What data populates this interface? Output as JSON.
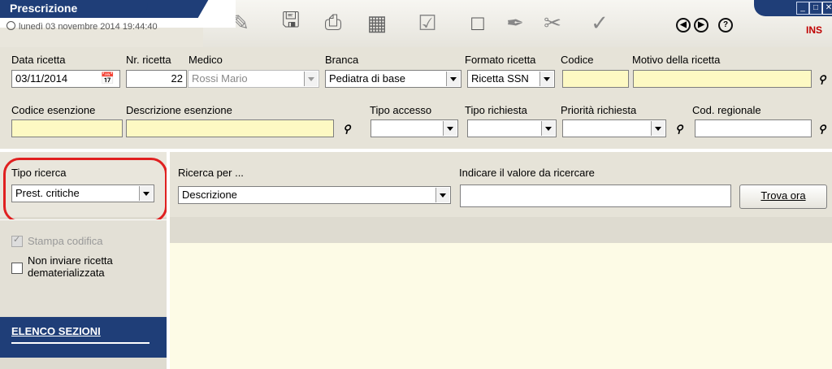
{
  "window": {
    "title": "Prescrizione",
    "datetime": "lunedì 03 novembre 2014   19:44:40",
    "mode": "INS"
  },
  "toolbar_icons": [
    "pencil-icon",
    "save-icon",
    "print-icon",
    "preview-icon",
    "note-icon",
    "stamp-icon",
    "pen-icon",
    "scissors-icon",
    "sign-icon",
    "prev-icon",
    "next-icon",
    "help-icon"
  ],
  "form": {
    "data_ricetta": {
      "label": "Data ricetta",
      "value": "03/11/2014"
    },
    "nr_ricetta": {
      "label": "Nr. ricetta",
      "value": "22"
    },
    "medico": {
      "label": "Medico",
      "value": "Rossi Mario"
    },
    "branca": {
      "label": "Branca",
      "value": "Pediatra di base"
    },
    "formato": {
      "label": "Formato ricetta",
      "value": "Ricetta SSN"
    },
    "codice": {
      "label": "Codice",
      "value": ""
    },
    "motivo": {
      "label": "Motivo della ricetta",
      "value": ""
    },
    "codice_esenzione": {
      "label": "Codice esenzione",
      "value": ""
    },
    "descrizione_esenzione": {
      "label": "Descrizione esenzione",
      "value": ""
    },
    "tipo_accesso": {
      "label": "Tipo accesso",
      "value": ""
    },
    "tipo_richiesta": {
      "label": "Tipo richiesta",
      "value": ""
    },
    "priorita": {
      "label": "Priorità richiesta",
      "value": ""
    },
    "cod_regionale": {
      "label": "Cod. regionale",
      "value": ""
    }
  },
  "left": {
    "tipo_ricerca_label": "Tipo ricerca",
    "tipo_ricerca_value": "Prest. critiche",
    "stampa_codifica": "Stampa codifica",
    "non_inviare": "Non inviare ricetta dematerializzata",
    "elenco_sezioni": "ELENCO SEZIONI"
  },
  "search": {
    "ricerca_per_label": "Ricerca per ...",
    "ricerca_per_value": "Descrizione",
    "valore_label": "Indicare il valore da ricercare",
    "valore_value": "",
    "trova_button": "Trova ora"
  },
  "colors": {
    "title_bg": "#1f3e78",
    "highlight": "#e02020",
    "required_field": "#fdf9c3",
    "mode_text": "#c00000"
  }
}
